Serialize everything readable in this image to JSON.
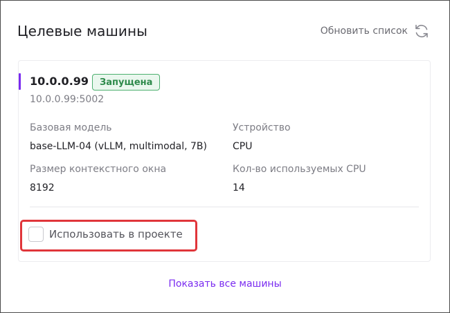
{
  "header": {
    "title": "Целевые машины",
    "refresh_label": "Обновить список"
  },
  "machine": {
    "name": "10.0.0.99",
    "status": "Запущена",
    "address": "10.0.0.99:5002",
    "fields": {
      "base_model_label": "Базовая модель",
      "base_model_value": "base-LLM-04 (vLLM, multimodal, 7B)",
      "device_label": "Устройство",
      "device_value": "CPU",
      "context_label": "Размер контекстного окна",
      "context_value": "8192",
      "cpu_count_label": "Кол-во используемых CPU",
      "cpu_count_value": "14"
    },
    "use_in_project_label": "Использовать в проекте",
    "use_in_project_checked": false
  },
  "footer": {
    "show_all_label": "Показать все машины"
  },
  "colors": {
    "accent": "#7a2bf0",
    "status_text": "#2e8a4b",
    "status_bg": "#eaf7ee",
    "highlight": "#e0353a"
  },
  "icons": {
    "refresh": "refresh-icon"
  }
}
